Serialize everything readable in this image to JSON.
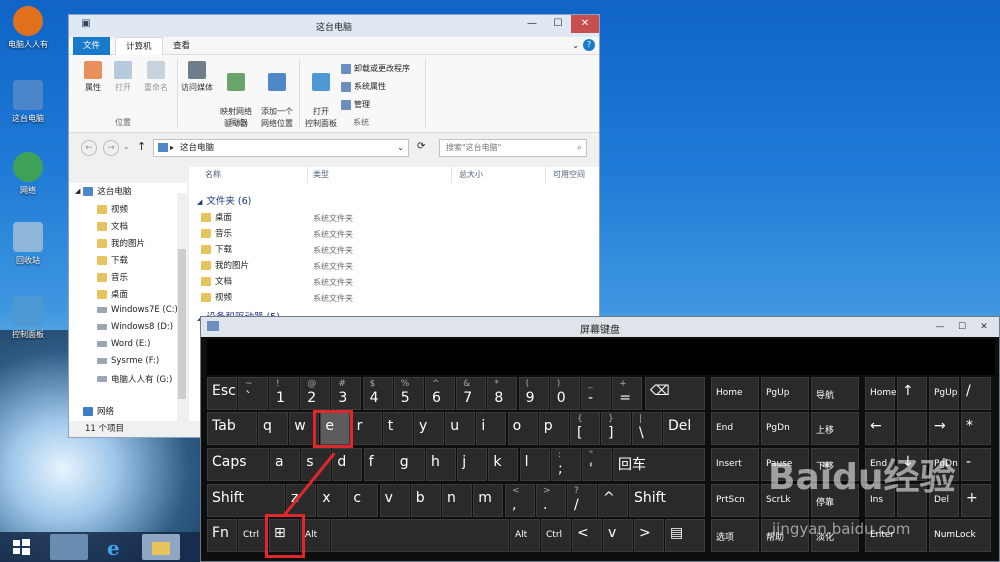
{
  "desktop": {
    "icons": [
      {
        "label": "电脑人人有",
        "color": "#e0701d"
      },
      {
        "label": "这台电脑",
        "color": "#4a86c9"
      },
      {
        "label": "网络",
        "color": "#3fa057"
      },
      {
        "label": "回收站",
        "color": "#8db6d9"
      },
      {
        "label": "控制面板",
        "color": "#4e99d3"
      }
    ]
  },
  "explorer": {
    "title": "这台电脑",
    "tabs": [
      "文件",
      "计算机",
      "查看"
    ],
    "ribbon": {
      "location": {
        "label": "位置",
        "items": [
          "属性",
          "打开",
          "重命名"
        ]
      },
      "network": {
        "label": "网络",
        "items": [
          "访问媒体",
          "映射网络\n驱动器",
          "添加一个\n网络位置"
        ]
      },
      "system": {
        "label": "系统",
        "open_cp": "打开\n控制面板",
        "small": [
          "卸载或更改程序",
          "系统属性",
          "管理"
        ]
      }
    },
    "address": "这台电脑",
    "search_placeholder": "搜索\"这台电脑\"",
    "nav": {
      "root": "这台电脑",
      "items": [
        "视频",
        "文档",
        "我的图片",
        "下载",
        "音乐",
        "桌面",
        "Windows7E (C:)",
        "Windows8 (D:)",
        "Word (E:)",
        "Sysrme (F:)",
        "电脑人人有 (G:)"
      ],
      "network": "网络"
    },
    "columns": [
      "名称",
      "类型",
      "总大小",
      "可用空间"
    ],
    "group_title": "文件夹 (6)",
    "folders": [
      {
        "name": "桌面",
        "type": "系统文件夹"
      },
      {
        "name": "音乐",
        "type": "系统文件夹"
      },
      {
        "name": "下载",
        "type": "系统文件夹"
      },
      {
        "name": "我的图片",
        "type": "系统文件夹"
      },
      {
        "name": "文档",
        "type": "系统文件夹"
      },
      {
        "name": "视频",
        "type": "系统文件夹"
      }
    ],
    "group2_partial": "设备和驱动器 (5)",
    "status": "11 个项目"
  },
  "osk": {
    "title": "屏幕键盘",
    "keys": {
      "esc": "Esc",
      "backquote": [
        "~",
        "`"
      ],
      "digits": [
        [
          "!",
          "1"
        ],
        [
          "@",
          "2"
        ],
        [
          "#",
          "3"
        ],
        [
          "$",
          "4"
        ],
        [
          "%",
          "5"
        ],
        [
          "^",
          "6"
        ],
        [
          "&",
          "7"
        ],
        [
          "*",
          "8"
        ],
        [
          "(",
          "9"
        ],
        [
          ")",
          "0"
        ],
        [
          "_",
          "-"
        ],
        [
          "+",
          "="
        ]
      ],
      "tab": "Tab",
      "row2": [
        "q",
        "w",
        "e",
        "r",
        "t",
        "y",
        "u",
        "i",
        "o",
        "p"
      ],
      "brace_open": [
        "{",
        "["
      ],
      "brace_close": [
        "}",
        "]"
      ],
      "pipe": [
        "|",
        "\\"
      ],
      "del": "Del",
      "caps": "Caps",
      "row3": [
        "a",
        "s",
        "d",
        "f",
        "g",
        "h",
        "j",
        "k",
        "l"
      ],
      "semicolon": [
        ":",
        ";"
      ],
      "quote": [
        "\"",
        "'"
      ],
      "enter": "回车",
      "shift": "Shift",
      "row4": [
        "z",
        "x",
        "c",
        "v",
        "b",
        "n",
        "m"
      ],
      "comma": [
        "<",
        ","
      ],
      "period": [
        ">",
        "."
      ],
      "slash": [
        "?",
        "/"
      ],
      "up": "^",
      "shift_r": "Shift",
      "fn": "Fn",
      "ctrl": "Ctrl",
      "win": "⊞",
      "alt": "Alt",
      "alt_r": "Alt",
      "ctrl_r": "Ctrl",
      "left": "<",
      "down": "v",
      "right": ">",
      "menu": "▤",
      "nav": [
        "Home",
        "PgUp",
        "导航",
        "End",
        "PgDn",
        "上移",
        "Insert",
        "Pause",
        "下移",
        "PrtScn",
        "ScrLk",
        "停靠",
        "选项",
        "帮助",
        "淡化"
      ],
      "numpad": [
        "Home",
        "↑",
        "PgUp",
        "/",
        "←",
        "→",
        "*",
        "End",
        "↓",
        "PgDn",
        "-",
        "Ins",
        "Del",
        "+",
        "Enter",
        "NumLock"
      ]
    }
  },
  "watermark": {
    "logo": "Baidu经验",
    "url": "jingyan.baidu.com"
  }
}
